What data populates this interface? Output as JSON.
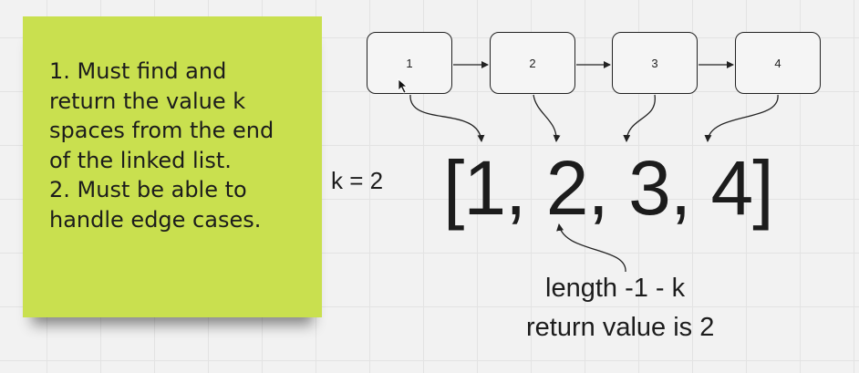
{
  "sticky_note": {
    "lines": [
      "1. Must find and",
      "return the value k",
      "spaces from the end",
      "of the linked list.",
      "2. Must be able to",
      "handle edge cases."
    ]
  },
  "linked_list": {
    "nodes": [
      "1",
      "2",
      "3",
      "4"
    ]
  },
  "k_label": "k = 2",
  "array_text": "[1, 2, 3, 4]",
  "formula": "length -1 - k",
  "result": "return value is 2",
  "colors": {
    "sticky": "#c9e04f",
    "stroke": "#222222",
    "background": "#f2f2f2"
  }
}
